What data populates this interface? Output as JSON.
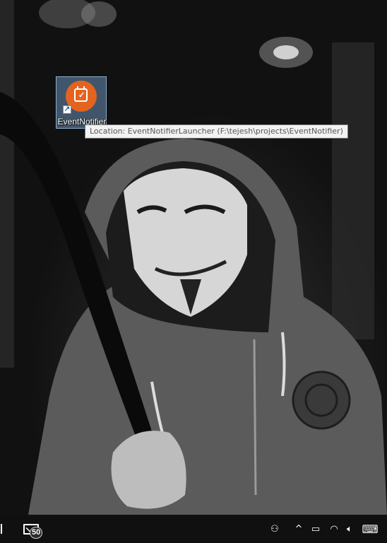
{
  "desktop": {
    "icon": {
      "label": "EventNotifier",
      "icon_name": "event-notifier-calendar-icon",
      "shortcut_overlay": "shortcut-arrow-icon",
      "check_glyph": "✓",
      "accent_color": "#e3641f"
    },
    "tooltip": {
      "text": "Location: EventNotifierLauncher (F:\\tejesh\\projects\\EventNotifier)"
    },
    "wallpaper": "grayscale-photo-masked-figure"
  },
  "taskbar": {
    "mail": {
      "icon_name": "mail-icon",
      "badge_count": "50"
    },
    "tray": {
      "people_glyph": "⚇",
      "chevron_glyph": "^",
      "battery_glyph": "▭",
      "wifi_glyph": "◠",
      "volume_glyph": "🔈︎",
      "keyboard_glyph": "⌨"
    }
  }
}
